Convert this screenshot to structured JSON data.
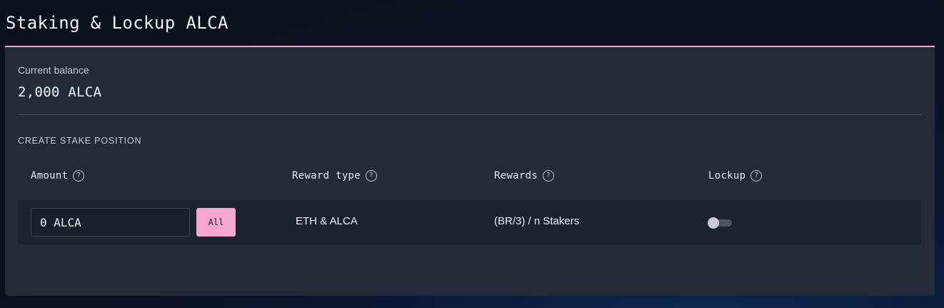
{
  "page": {
    "title": "Staking & Lockup ALCA"
  },
  "balance": {
    "label": "Current balance",
    "value": "2,000 ALCA"
  },
  "section": {
    "label": "CREATE STAKE POSITION"
  },
  "columns": {
    "amount": "Amount",
    "reward_type": "Reward type",
    "rewards": "Rewards",
    "lockup": "Lockup"
  },
  "help_icon": {
    "glyph": "?",
    "icon": "question-circle-icon"
  },
  "stake_row": {
    "amount_value": "0 ALCA",
    "all_button_label": "All",
    "reward_type": "ETH & ALCA",
    "rewards": "(BR/3) / n Stakers",
    "lockup_enabled": false
  },
  "colors": {
    "accent": "#f6a7d0",
    "panel": "#232b38",
    "row": "#1c2330"
  }
}
